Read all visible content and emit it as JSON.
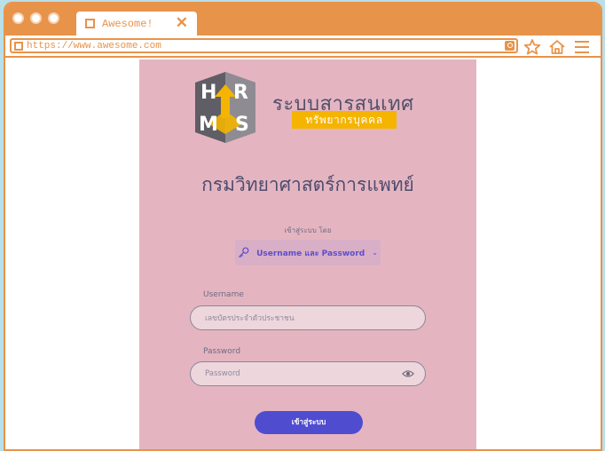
{
  "browser": {
    "tab": {
      "title": "Awesome!",
      "close_glyph": "✕"
    },
    "address_bar": {
      "url": "https://www.awesome.com"
    },
    "nav_icons": [
      "search-go-icon",
      "star-icon",
      "home-icon",
      "menu-icon"
    ],
    "colors": {
      "chrome": "#e8934a",
      "background": "#b9dfe9"
    }
  },
  "brand": {
    "logo_letters": "HRMS",
    "system_name": "ระบบสารสนเทศ",
    "system_subtitle": "ทรัพยากรบุคคล"
  },
  "department": "กรมวิทยาศาสตร์การแพทย์",
  "login": {
    "login_by_label": "เข้าสู่ระบบ โดย",
    "method_label": "Username และ Password",
    "username": {
      "label": "Username",
      "placeholder": "เลขบัตรประจำตัวประชาชน"
    },
    "password": {
      "label": "Password",
      "placeholder": "Password"
    },
    "submit_label": "เข้าสู่ระบบ"
  },
  "colors": {
    "panel": "#e4b5c1",
    "accent": "#4f4ccf",
    "brand_badge": "#f4b400"
  }
}
